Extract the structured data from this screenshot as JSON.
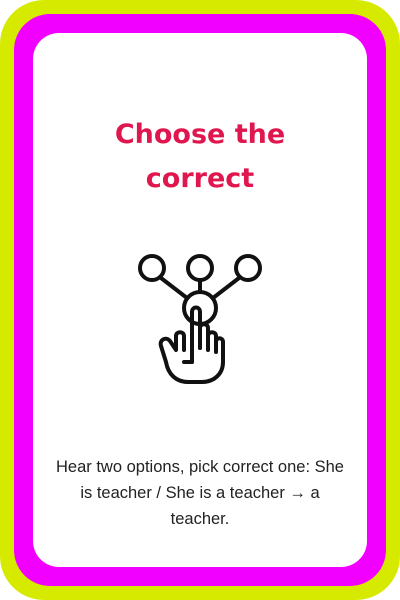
{
  "card": {
    "title": "Choose the correct",
    "icon": "hand-select-options-icon",
    "description": "Hear two options, pick correct one: She is teacher / She is a teacher → a teacher."
  },
  "colors": {
    "outer_frame": "#d6ea00",
    "inner_frame": "#f200ff",
    "title": "#e0174e",
    "card_background": "#ffffff"
  }
}
